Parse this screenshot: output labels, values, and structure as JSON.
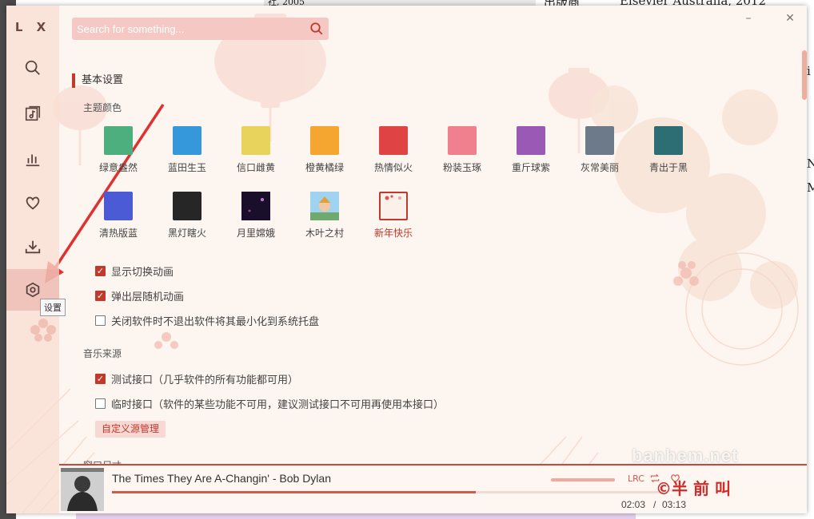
{
  "background_doc": {
    "texts": [
      "出版商",
      "Elsevier Australia, 2012",
      "i",
      "N",
      "M",
      "社, 2005"
    ]
  },
  "app": {
    "logo": "L X",
    "tooltip": "设置",
    "nav": [
      {
        "icon": "search-icon"
      },
      {
        "icon": "music-list-icon"
      },
      {
        "icon": "leaderboard-icon"
      },
      {
        "icon": "heart-icon"
      },
      {
        "icon": "download-icon"
      },
      {
        "icon": "settings-icon"
      }
    ],
    "search": {
      "placeholder": "Search for something..."
    },
    "window": {
      "minimize": "–",
      "close": "✕"
    },
    "settings": {
      "section_basic": "基本设置",
      "theme_label": "主题颜色",
      "themes": [
        {
          "name": "绿意盎然",
          "color": "#4caf7d"
        },
        {
          "name": "蓝田生玉",
          "color": "#3498db"
        },
        {
          "name": "信口雌黄",
          "color": "#e8d35c"
        },
        {
          "name": "橙黄橘绿",
          "color": "#f5a631"
        },
        {
          "name": "热情似火",
          "color": "#e04343"
        },
        {
          "name": "粉装玉琢",
          "color": "#f0808d"
        },
        {
          "name": "重斤球紫",
          "color": "#9b59b6"
        },
        {
          "name": "灰常美丽",
          "color": "#6c7a89"
        },
        {
          "name": "青出于黑",
          "color": "#2c6e74"
        },
        {
          "name": "清热版蓝",
          "color": "#4b5bd6"
        },
        {
          "name": "黑灯瞎火",
          "color": "#262626"
        },
        {
          "name": "月里嫦娥",
          "color": "#2a1a3a"
        },
        {
          "name": "木叶之村",
          "color": "#8ecae6"
        },
        {
          "name": "新年快乐",
          "color": "#fbf1ea",
          "selected": true
        }
      ],
      "checks": [
        {
          "label": "显示切换动画",
          "checked": true
        },
        {
          "label": "弹出层随机动画",
          "checked": true
        },
        {
          "label": "关闭软件时不退出软件将其最小化到系统托盘",
          "checked": false
        }
      ],
      "source_label": "音乐来源",
      "sources": [
        {
          "label": "测试接口（几乎软件的所有功能都可用）",
          "checked": true
        },
        {
          "label": "临时接口（软件的某些功能不可用，建议测试接口不可用再使用本接口）",
          "checked": false
        }
      ],
      "custom_source_button": "自定义源管理",
      "next_section_cut": "窗口尺寸"
    },
    "player": {
      "title": "The Times They Are A-Changin' - Bob Dylan",
      "progress": 0.66,
      "current_time": "02:03",
      "separator": "/",
      "total_time": "03:13",
      "lrc_label": "LRC",
      "volume": 1.0
    },
    "watermark": {
      "site": "banhem.net",
      "mark": "©半 前 叫"
    }
  }
}
